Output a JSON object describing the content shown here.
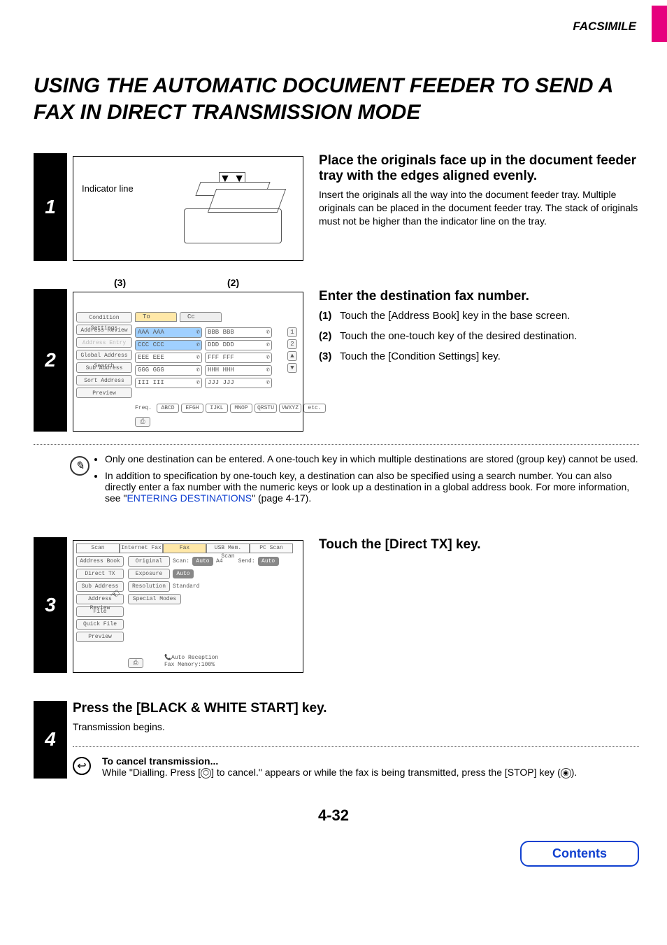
{
  "header": {
    "section": "FACSIMILE"
  },
  "title": "USING THE AUTOMATIC DOCUMENT FEEDER TO SEND A FAX IN DIRECT TRANSMISSION MODE",
  "step1": {
    "num": "1",
    "indicator": "Indicator line",
    "heading": "Place the originals face up in the document feeder tray with the edges aligned evenly.",
    "body": "Insert the originals all the way into the document feeder tray. Multiple originals can be placed in the document feeder tray. The stack of originals must not be higher than the indicator line on the tray."
  },
  "step2": {
    "num": "2",
    "anno3": "(3)",
    "anno2": "(2)",
    "heading": "Enter the destination fax number.",
    "items": [
      {
        "n": "(1)",
        "t": "Touch the [Address Book] key in the base screen."
      },
      {
        "n": "(2)",
        "t": "Touch the one-touch key of the desired destination."
      },
      {
        "n": "(3)",
        "t": "Touch the [Condition Settings] key."
      }
    ],
    "side": [
      "Condition Settings",
      "Address Review",
      "Address Entry",
      "Global Address Search",
      "Sub Address",
      "Sort Address",
      "Preview"
    ],
    "tabs": {
      "to": "To",
      "cc": "Cc"
    },
    "touchkeys": [
      [
        "AAA AAA",
        "BBB BBB"
      ],
      [
        "CCC CCC",
        "DDD DDD"
      ],
      [
        "EEE EEE",
        "FFF FFF"
      ],
      [
        "GGG GGG",
        "HHH HHH"
      ],
      [
        "III III",
        "JJJ JJJ"
      ]
    ],
    "scroll_nums": [
      "1",
      "2"
    ],
    "freq_label": "Freq.",
    "freq": [
      "ABCD",
      "EFGH",
      "IJKL",
      "MNOP",
      "QRSTU",
      "VWXYZ",
      "etc."
    ]
  },
  "note2": {
    "b1": "Only one destination can be entered. A one-touch key in which multiple destinations are stored (group key) cannot be used.",
    "b2a": "In addition to specification by one-touch key, a destination can also be specified using a search number. You can also directly enter a fax number with the numeric keys or look up a destination in a global address book. For more information, see \"",
    "b2link": "ENTERING DESTINATIONS",
    "b2b": "\" (page 4-17)."
  },
  "step3": {
    "num": "3",
    "heading": "Touch the [Direct TX] key.",
    "toptabs": [
      "Scan",
      "Internet Fax",
      "Fax",
      "USB Mem. Scan",
      "PC Scan"
    ],
    "left": [
      "Address Book",
      "Direct TX",
      "Sub Address",
      "Address Review",
      "File",
      "Quick File",
      "Preview"
    ],
    "rows": {
      "original": "Original",
      "scan": "Scan:",
      "scan_v": "Auto",
      "size": "A4",
      "send": "Send:",
      "send_v": "Auto",
      "exposure": "Exposure",
      "exp_v": "Auto",
      "resolution": "Resolution",
      "res_v": "Standard",
      "special": "Special Modes"
    },
    "footer1": "Auto Reception",
    "footer2": "Fax Memory:100%"
  },
  "step4": {
    "num": "4",
    "heading": "Press the [BLACK & WHITE START] key.",
    "body": "Transmission begins.",
    "cancel_h": "To cancel transmission...",
    "cancel_a": "While \"Dialling. Press [",
    "cancel_b": "] to cancel.\" appears or while the fax is being transmitted, press the [STOP] key (",
    "cancel_c": ")."
  },
  "footer": {
    "page": "4-32",
    "contents": "Contents"
  }
}
